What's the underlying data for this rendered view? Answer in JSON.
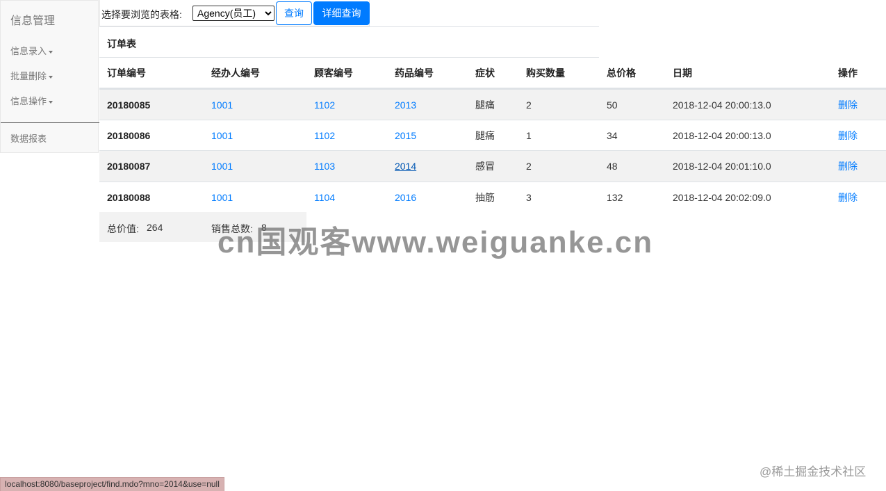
{
  "sidebar": {
    "brand": "信息管理",
    "menu": [
      {
        "label": "信息录入"
      },
      {
        "label": "批量删除"
      },
      {
        "label": "信息操作"
      }
    ],
    "report": "数据报表"
  },
  "toolbar": {
    "label": "选择要浏览的表格:",
    "select_value": "Agency(员工)",
    "query_button": "查询",
    "detail_button": "详细查询"
  },
  "card": {
    "title": "订单表"
  },
  "table": {
    "headers": [
      "订单编号",
      "经办人编号",
      "顾客编号",
      "药品编号",
      "症状",
      "购买数量",
      "总价格",
      "日期",
      "操作"
    ],
    "rows": [
      {
        "order_no": "20180085",
        "agent_no": "1001",
        "customer_no": "1102",
        "drug_no": "2013",
        "symptom": "腿痛",
        "quantity": "2",
        "total": "50",
        "date": "2018-12-04 20:00:13.0",
        "action": "删除"
      },
      {
        "order_no": "20180086",
        "agent_no": "1001",
        "customer_no": "1102",
        "drug_no": "2015",
        "symptom": "腿痛",
        "quantity": "1",
        "total": "34",
        "date": "2018-12-04 20:00:13.0",
        "action": "删除"
      },
      {
        "order_no": "20180087",
        "agent_no": "1001",
        "customer_no": "1103",
        "drug_no": "2014",
        "symptom": "感冒",
        "quantity": "2",
        "total": "48",
        "date": "2018-12-04 20:01:10.0",
        "action": "删除"
      },
      {
        "order_no": "20180088",
        "agent_no": "1001",
        "customer_no": "1104",
        "drug_no": "2016",
        "symptom": "抽筋",
        "quantity": "3",
        "total": "132",
        "date": "2018-12-04 20:02:09.0",
        "action": "删除"
      }
    ]
  },
  "summary": {
    "total_label": "总价值:",
    "total_value": "264",
    "sales_label": "销售总数:",
    "sales_value": "8"
  },
  "watermarks": {
    "main": "cn国观客www.weiguanke.cn",
    "corner": "@稀土掘金技术社区"
  },
  "status_bar": {
    "url": "localhost:8080/baseproject/find.mdo?mno=2014&use=null"
  },
  "colors": {
    "link": "#007bff",
    "stripe": "#f2f2f2",
    "sidebar_bg": "#f8f8f8",
    "status_bg": "#d7b2b2"
  },
  "icons": {
    "menu_caret": "caret-down-icon"
  }
}
